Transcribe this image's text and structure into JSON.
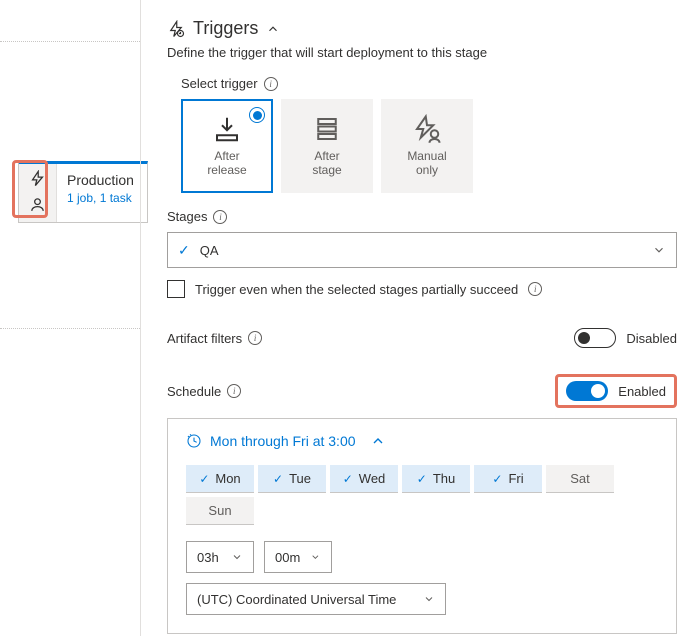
{
  "stage_card": {
    "title": "Production",
    "subtitle": "1 job, 1 task"
  },
  "panel": {
    "title": "Triggers",
    "description": "Define the trigger that will start deployment to this stage"
  },
  "select_trigger_label": "Select trigger",
  "triggers": {
    "after_release": "After\nrelease",
    "after_stage": "After\nstage",
    "manual_only": "Manual\nonly"
  },
  "stages": {
    "label": "Stages",
    "selected": "QA",
    "checkbox_label": "Trigger even when the selected stages partially succeed"
  },
  "artifact": {
    "label": "Artifact filters",
    "state": "Disabled"
  },
  "schedule": {
    "label": "Schedule",
    "state": "Enabled",
    "summary": "Mon through Fri at 3:00",
    "days": {
      "mon": "Mon",
      "tue": "Tue",
      "wed": "Wed",
      "thu": "Thu",
      "fri": "Fri",
      "sat": "Sat",
      "sun": "Sun"
    },
    "hour": "03h",
    "minute": "00m",
    "timezone": "(UTC) Coordinated Universal Time"
  }
}
